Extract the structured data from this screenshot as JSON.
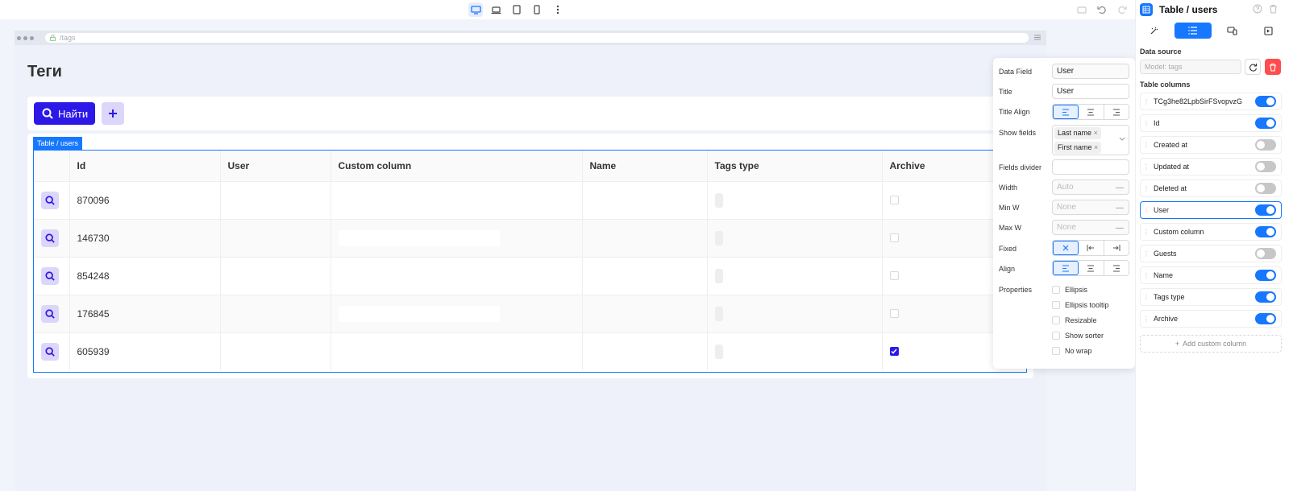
{
  "url": "/tags",
  "page_title": "Теги",
  "find_button": "Найти",
  "table_tag": "Table / users",
  "table": {
    "columns": [
      "Id",
      "User",
      "Custom column",
      "Name",
      "Tags type",
      "Archive"
    ],
    "rows": [
      {
        "id": "870096",
        "archive": false
      },
      {
        "id": "146730",
        "archive": false
      },
      {
        "id": "854248",
        "archive": false
      },
      {
        "id": "176845",
        "archive": false
      },
      {
        "id": "605939",
        "archive": true
      }
    ]
  },
  "settings": {
    "data_field_label": "Data Field",
    "data_field_value": "User",
    "title_label": "Title",
    "title_value": "User",
    "title_align_label": "Title Align",
    "show_fields_label": "Show fields",
    "show_fields_chips": [
      "Last name",
      "First name"
    ],
    "fields_divider_label": "Fields divider",
    "width_label": "Width",
    "width_placeholder": "Auto",
    "minw_label": "Min W",
    "minw_placeholder": "None",
    "maxw_label": "Max W",
    "maxw_placeholder": "None",
    "fixed_label": "Fixed",
    "align_label": "Align",
    "properties_label": "Properties",
    "properties": [
      "Ellipsis",
      "Ellipsis tooltip",
      "Resizable",
      "Show sorter",
      "No wrap"
    ]
  },
  "panel": {
    "title": "Table / users",
    "data_source_label": "Data source",
    "data_source_placeholder": "Model: tags",
    "table_columns_label": "Table columns",
    "columns": [
      {
        "name": "TCg3he82LpbSirFSvopvzG",
        "on": true
      },
      {
        "name": "Id",
        "on": true
      },
      {
        "name": "Created at",
        "on": false
      },
      {
        "name": "Updated at",
        "on": false
      },
      {
        "name": "Deleted at",
        "on": false
      },
      {
        "name": "User",
        "on": true
      },
      {
        "name": "Custom column",
        "on": true
      },
      {
        "name": "Guests",
        "on": false
      },
      {
        "name": "Name",
        "on": true
      },
      {
        "name": "Tags type",
        "on": true
      },
      {
        "name": "Archive",
        "on": true
      }
    ],
    "add_column": "Add custom column"
  },
  "colors": {
    "primary": "#2c19e8",
    "accent": "#1677ff",
    "danger": "#ff4d4f"
  }
}
